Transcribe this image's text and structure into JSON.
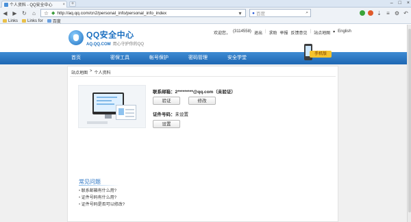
{
  "browser": {
    "tab_title": "个人资料 - QQ安全中心",
    "tab_close": "×",
    "new_tab": "+",
    "window_controls": [
      "–",
      "□",
      "×"
    ],
    "url": "http://aq.qq.com/cn2/personal_info/personal_info_index",
    "search_engine_label": "百度",
    "bookmarks": [
      "Links",
      "Links for",
      "百度"
    ]
  },
  "site": {
    "logo_title": "QQ安全中心",
    "logo_domain": "AQ.QQ.COM",
    "logo_slogan": "用心守护你的QQ",
    "top_nav": {
      "welcome": "欢迎您，",
      "account": "(3114558)",
      "logout": "退出",
      "help": "求助",
      "feedback": "举报",
      "security_tips": "反馈意见",
      "sitemap": "站点地图",
      "language": "English"
    },
    "main_nav": [
      "首页",
      "密保工具",
      "帐号保护",
      "密码管理",
      "安全学堂"
    ],
    "phone_badge": "手机版"
  },
  "content": {
    "breadcrumb": [
      "站点地图",
      ">",
      "个人资料"
    ],
    "email_label": "联系邮箱：",
    "email_value": "2*********@qq.com（未验证）",
    "verify_button": "验证",
    "modify_button": "修改",
    "id_label": "证件号码：",
    "id_value": "未设置",
    "set_button": "设置",
    "faq_title": "常见问题",
    "faq_items": [
      "联系邮箱有什么用?",
      "证件号码有什么用?",
      "证件号码是否可以修改?"
    ]
  }
}
